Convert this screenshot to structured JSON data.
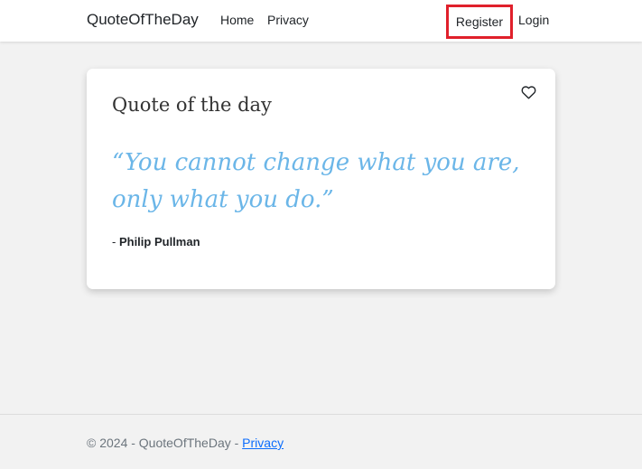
{
  "navbar": {
    "brand": "QuoteOfTheDay",
    "links": {
      "home": "Home",
      "privacy": "Privacy",
      "register": "Register",
      "login": "Login"
    }
  },
  "card": {
    "title": "Quote of the day",
    "quote": "“You cannot change what you are, only what you do.”",
    "author_prefix": "- ",
    "author": "Philip Pullman",
    "favorite_icon": "heart-outline-icon"
  },
  "footer": {
    "copyright": "© 2024 - QuoteOfTheDay - ",
    "privacy_link": "Privacy"
  },
  "colors": {
    "quote": "#6bb6e8",
    "highlight_border": "#e0202b",
    "link": "#0d6efd"
  }
}
